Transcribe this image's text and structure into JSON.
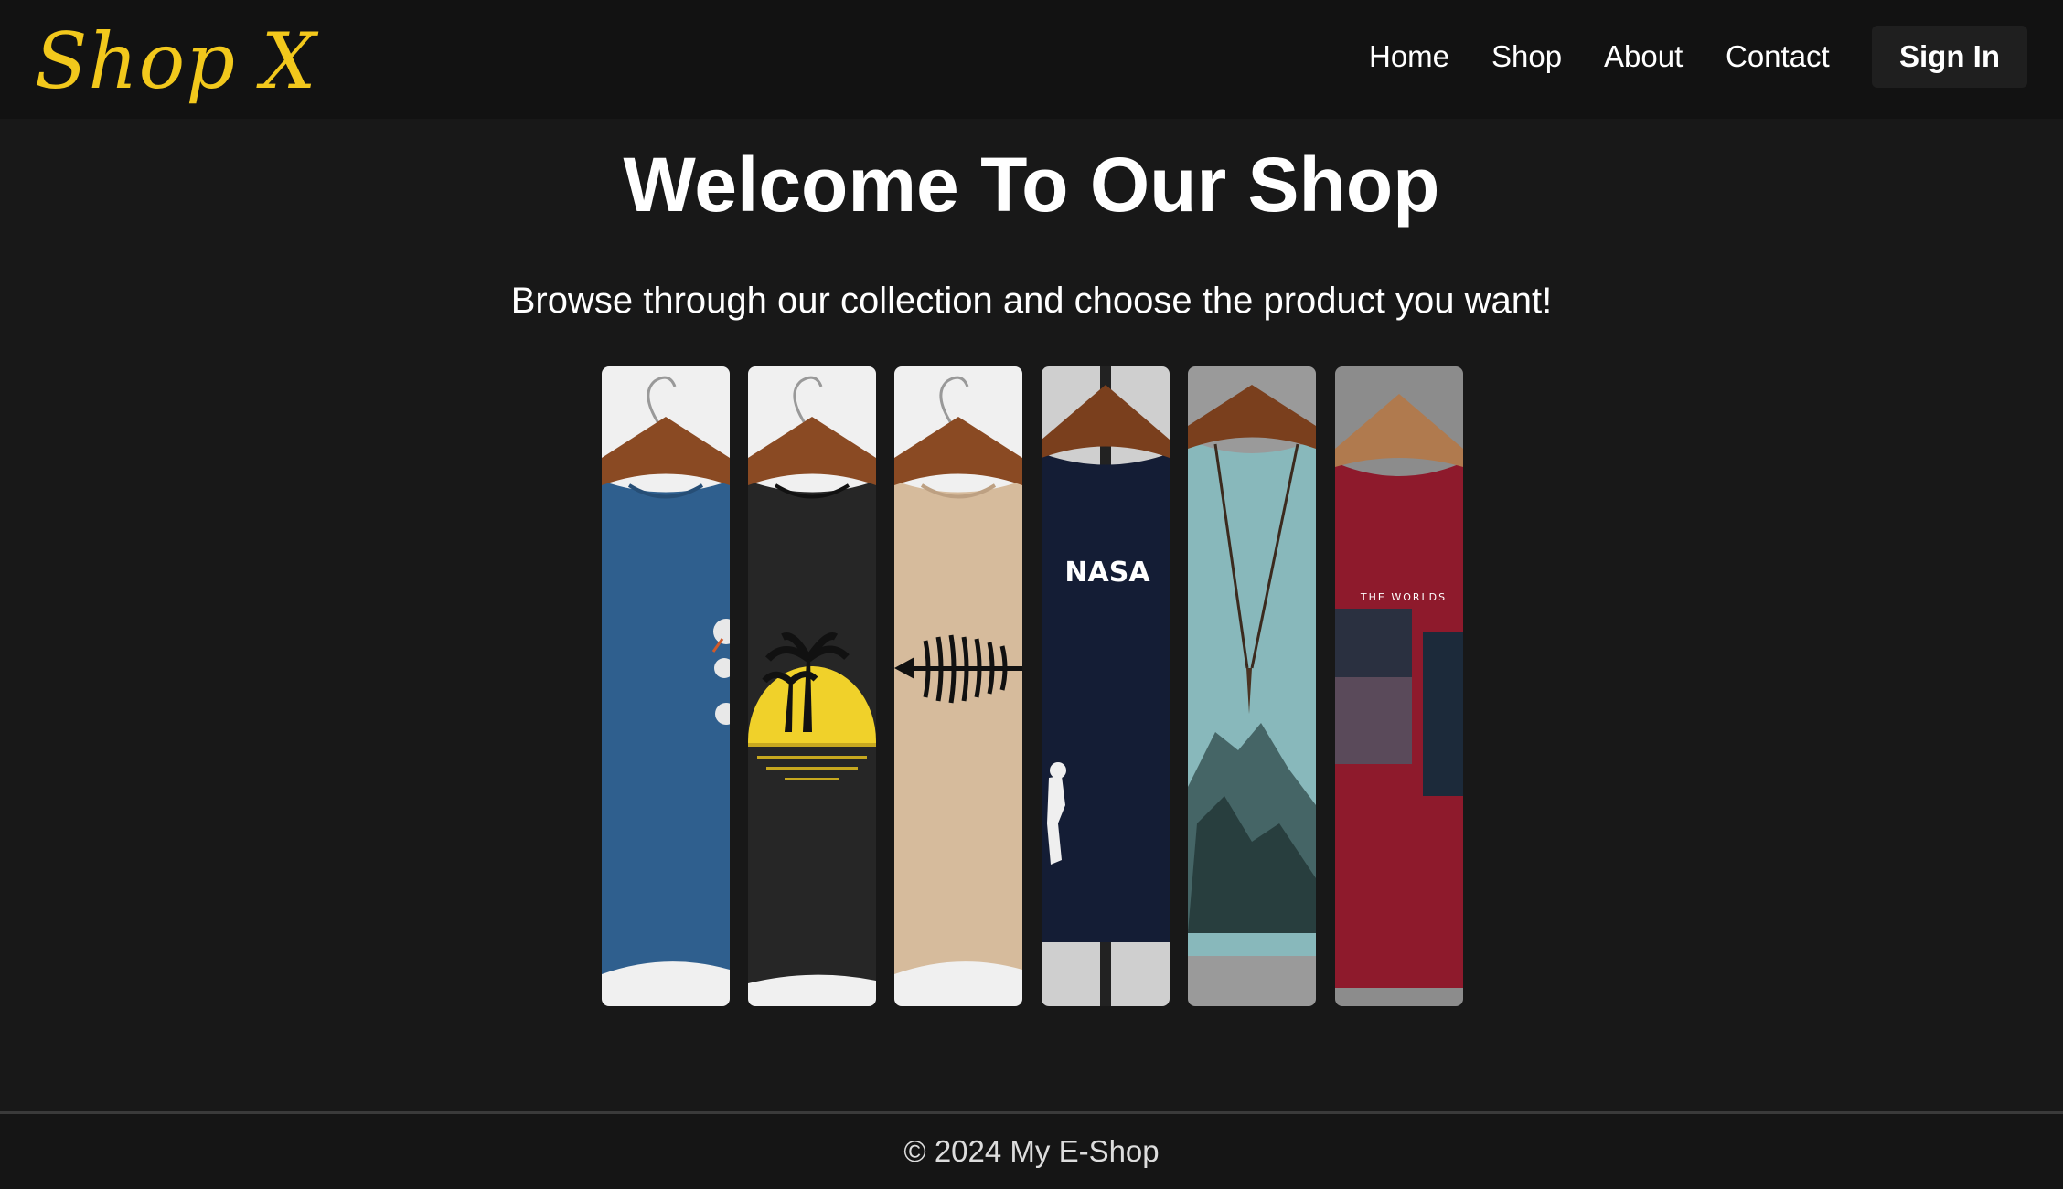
{
  "header": {
    "logo": "Shop X",
    "nav": [
      {
        "label": "Home"
      },
      {
        "label": "Shop"
      },
      {
        "label": "About"
      },
      {
        "label": "Contact"
      }
    ],
    "sign_in": "Sign In"
  },
  "hero": {
    "title": "Welcome To Our Shop",
    "subtitle": "Browse through our collection and choose the product you want!"
  },
  "products": [
    {
      "shirt_color": "#2f5f8e",
      "background": "#f0f0f0",
      "print": "snake-graphic"
    },
    {
      "shirt_color": "#262626",
      "background": "#f0f0f0",
      "print": "palm-sunset"
    },
    {
      "shirt_color": "#d6bb9c",
      "background": "#f0f0f0",
      "print": "fish-bone"
    },
    {
      "shirt_color": "#141d35",
      "background": "#cfcfcf",
      "print": "nasa-astronaut",
      "text": "NASA"
    },
    {
      "shirt_color": "#88b8bb",
      "background": "#9a9a9a",
      "print": "mountain-necklace"
    },
    {
      "shirt_color": "#8e1a2c",
      "background": "#8c8c8c",
      "print": "city-photo",
      "text": "THE WORLDS"
    }
  ],
  "footer": {
    "copyright": "© 2024 My E-Shop"
  },
  "colors": {
    "accent": "#f2c81c",
    "background": "#181818",
    "navbar": "#121212"
  }
}
